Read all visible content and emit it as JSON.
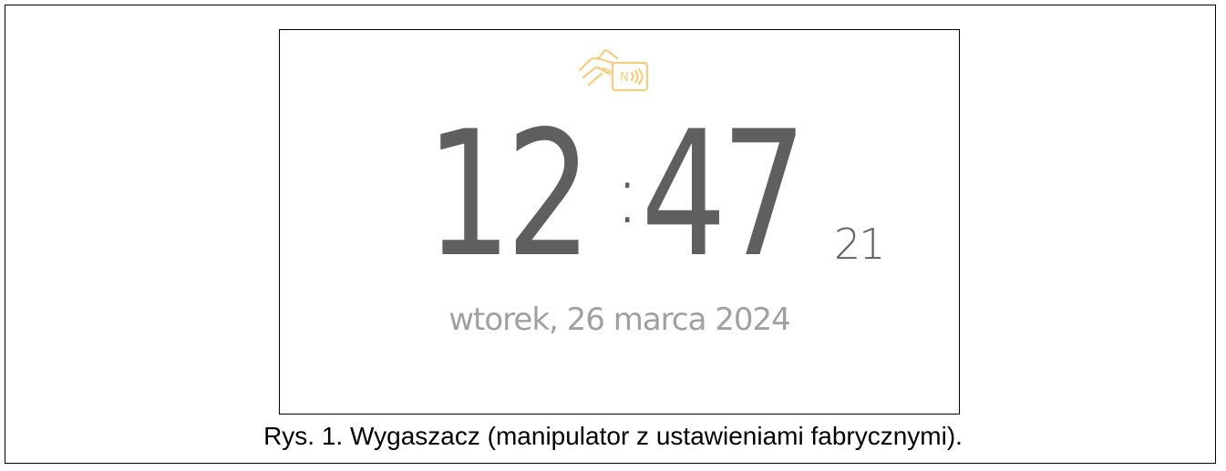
{
  "screen": {
    "icon": "card-reader-icon",
    "clock": {
      "hours": "12",
      "separator": ":",
      "minutes": "47",
      "seconds": "21"
    },
    "date": "wtorek, 26 marca 2024"
  },
  "caption": "Rys. 1. Wygaszacz (manipulator z ustawieniami fabrycznymi).",
  "colors": {
    "clock_text": "#5f5f5f",
    "date_text": "#a0a0a0",
    "icon_accent": "#f3c66b"
  }
}
